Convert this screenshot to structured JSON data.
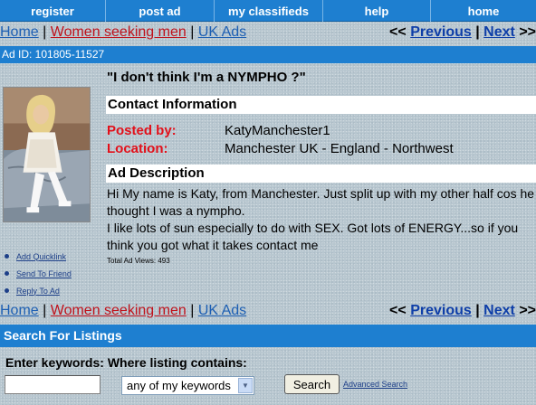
{
  "nav": {
    "items": [
      {
        "label": "register"
      },
      {
        "label": "post ad"
      },
      {
        "label": "my classifieds"
      },
      {
        "label": "help"
      },
      {
        "label": "home"
      }
    ],
    "bg_color": "#1e7fd0"
  },
  "breadcrumb": {
    "home": "Home",
    "category": "Women seeking men",
    "region": "UK Ads",
    "separator": "|"
  },
  "pager": {
    "prev_prefix": "<<",
    "previous": "Previous",
    "divider": "|",
    "next": "Next",
    "next_suffix": ">>"
  },
  "ad": {
    "id_label": "Ad ID: 101805-11527",
    "title": "\"I don't think I'm a NYMPHO ?\"",
    "contact_heading": "Contact Information",
    "posted_by_label": "Posted by:",
    "posted_by_value": "KatyManchester1",
    "location_label": "Location:",
    "location_value": "Manchester UK - England - Northwest",
    "description_heading": "Ad Description",
    "description_line1": "Hi My name is Katy, from Manchester. Just split up with my other half cos he thought I was a nympho.",
    "description_line2": "I like lots of sun especially to do with SEX. Got lots of ENERGY...so if you think you got what it takes contact me",
    "total_views": "Total Ad Views: 493"
  },
  "actions": [
    {
      "label": "Add Quicklink"
    },
    {
      "label": "Send To Friend"
    },
    {
      "label": "Reply To Ad"
    }
  ],
  "search": {
    "heading": "Search For Listings",
    "prompt": "Enter keywords: Where listing contains:",
    "keyword_value": "",
    "mode_selected": "any of my keywords",
    "button": "Search",
    "advanced": "Advanced Search"
  },
  "colors": {
    "label_red": "#e2101a",
    "link_blue": "#1d5fb3",
    "link_red": "#c0121b",
    "bar_blue": "#1e7fd0"
  }
}
